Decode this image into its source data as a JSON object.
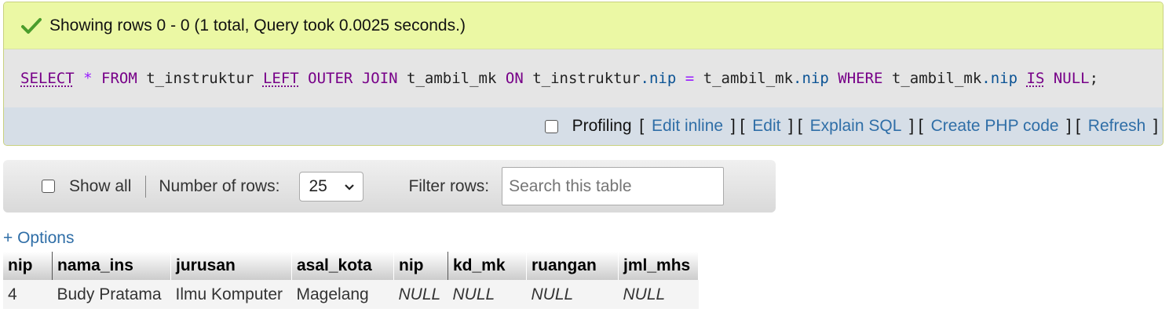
{
  "message": {
    "text": "Showing rows 0 - 0 (1 total, Query took 0.0025 seconds.)",
    "icon": "check-icon",
    "icon_color": "#4a9d2c",
    "background": "#ebf8a4"
  },
  "sql": {
    "t1": "SELECT",
    "t2": "*",
    "t3": "FROM",
    "t4": "t_instruktur",
    "t5": "LEFT",
    "t6": "OUTER",
    "t7": "JOIN",
    "t8": "t_ambil_mk",
    "t9": "ON",
    "t10": "t_instruktur",
    "t11": ".nip",
    "t12": "=",
    "t13": "t_ambil_mk",
    "t14": ".nip",
    "t15": "WHERE",
    "t16": "t_ambil_mk",
    "t17": ".nip",
    "t18": "IS",
    "t19": "NULL",
    "t20": ";"
  },
  "tools": {
    "profiling_label": "Profiling",
    "links": [
      "Edit inline",
      "Edit",
      "Explain SQL",
      "Create PHP code",
      "Refresh"
    ]
  },
  "nav": {
    "show_all_label": "Show all",
    "rows_label": "Number of rows:",
    "rows_value": "25",
    "filter_label": "Filter rows:",
    "search_placeholder": "Search this table"
  },
  "options_label": "+ Options",
  "table": {
    "columns": [
      "nip",
      "nama_ins",
      "jurusan",
      "asal_kota",
      "nip",
      "kd_mk",
      "ruangan",
      "jml_mhs"
    ],
    "rows": [
      [
        "4",
        "Budy Pratama",
        "Ilmu Komputer",
        "Magelang",
        "NULL",
        "NULL",
        "NULL",
        "NULL"
      ]
    ]
  }
}
